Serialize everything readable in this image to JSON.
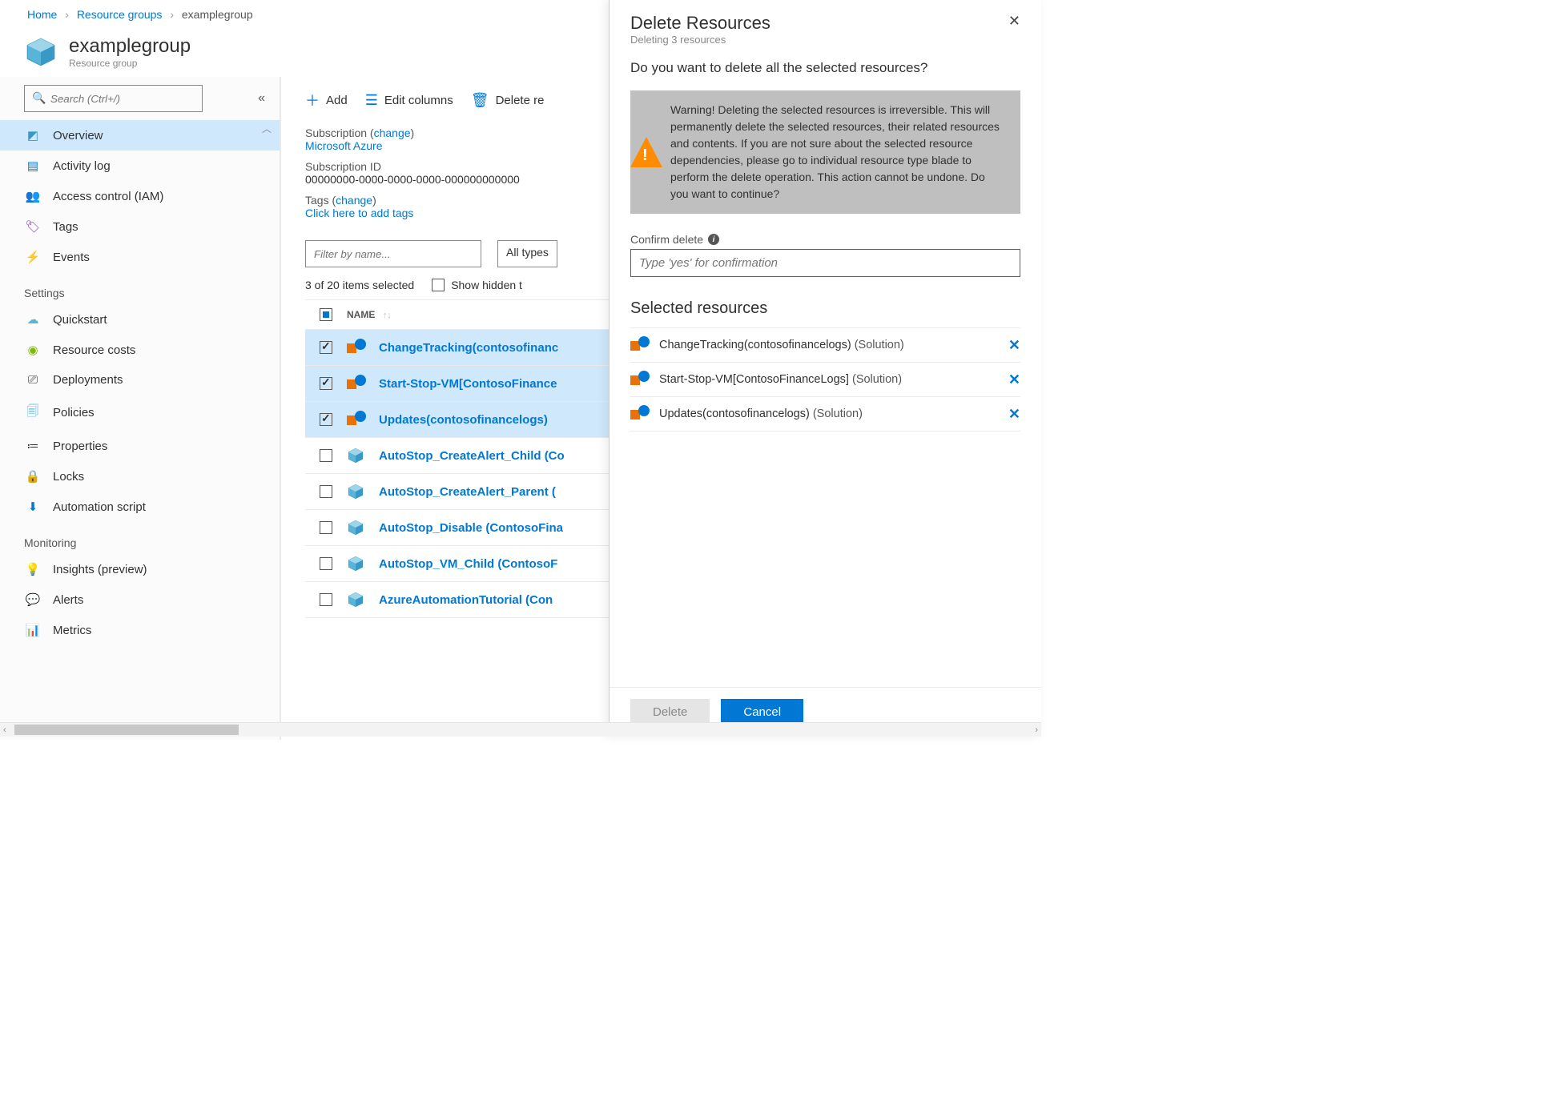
{
  "breadcrumb": {
    "home": "Home",
    "rg": "Resource groups",
    "current": "examplegroup"
  },
  "header": {
    "title": "examplegroup",
    "subtitle": "Resource group"
  },
  "search": {
    "placeholder": "Search (Ctrl+/)"
  },
  "nav": {
    "items": [
      "Overview",
      "Activity log",
      "Access control (IAM)",
      "Tags",
      "Events"
    ],
    "section_settings": "Settings",
    "settings": [
      "Quickstart",
      "Resource costs",
      "Deployments",
      "Policies",
      "Properties",
      "Locks",
      "Automation script"
    ],
    "section_monitoring": "Monitoring",
    "monitoring": [
      "Insights (preview)",
      "Alerts",
      "Metrics"
    ]
  },
  "toolbar": {
    "add": "Add",
    "edit": "Edit columns",
    "delete": "Delete re"
  },
  "info": {
    "sub_label": "Subscription",
    "sub_change": "change",
    "sub_val": "Microsoft Azure",
    "subid_label": "Subscription ID",
    "subid_val": "00000000-0000-0000-0000-000000000000",
    "tags_label": "Tags",
    "tags_change": "change",
    "tags_val": "Click here to add tags"
  },
  "filter": {
    "placeholder": "Filter by name...",
    "type": "All types"
  },
  "list": {
    "summary": "3 of 20 items selected",
    "hidden_label": "Show hidden t",
    "col_name": "NAME",
    "rows": [
      {
        "name": "ChangeTracking(contosofinanc",
        "icon": "solution",
        "selected": true
      },
      {
        "name": "Start-Stop-VM[ContosoFinance",
        "icon": "solution",
        "selected": true
      },
      {
        "name": "Updates(contosofinancelogs)",
        "icon": "solution",
        "selected": true
      },
      {
        "name": "AutoStop_CreateAlert_Child (Co",
        "icon": "cube",
        "selected": false
      },
      {
        "name": "AutoStop_CreateAlert_Parent (",
        "icon": "cube",
        "selected": false
      },
      {
        "name": "AutoStop_Disable (ContosoFina",
        "icon": "cube",
        "selected": false
      },
      {
        "name": "AutoStop_VM_Child (ContosoF",
        "icon": "cube",
        "selected": false
      },
      {
        "name": "AzureAutomationTutorial (Con",
        "icon": "cube",
        "selected": false
      }
    ]
  },
  "panel": {
    "title": "Delete Resources",
    "subtitle": "Deleting 3 resources",
    "question": "Do you want to delete all the selected resources?",
    "warning": "Warning! Deleting the selected resources is irreversible. This will permanently delete the selected resources, their related resources and contents. If you are not sure about the selected resource dependencies, please go to individual resource type blade to perform the delete operation. This action cannot be undone. Do you want to continue?",
    "confirm_label": "Confirm delete",
    "confirm_placeholder": "Type 'yes' for confirmation",
    "selected_heading": "Selected resources",
    "selected": [
      {
        "name": "ChangeTracking(contosofinancelogs)",
        "type": "(Solution)"
      },
      {
        "name": "Start-Stop-VM[ContosoFinanceLogs]",
        "type": "(Solution)"
      },
      {
        "name": "Updates(contosofinancelogs)",
        "type": "(Solution)"
      }
    ],
    "btn_delete": "Delete",
    "btn_cancel": "Cancel"
  }
}
